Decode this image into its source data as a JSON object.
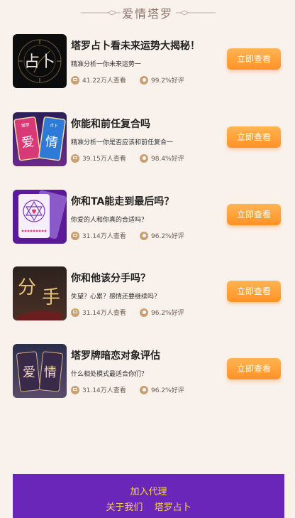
{
  "header": {
    "title": "爱情塔罗"
  },
  "items": [
    {
      "title": "塔罗占卜看未来运势大揭秘！",
      "desc": "精准分析一你未来运势一",
      "views": "41.22万人查看",
      "rating": "99.2%好评",
      "button": "立即查看",
      "thumb_text": "占卜"
    },
    {
      "title": "你能和前任复合吗",
      "desc": "精准分析一你是否应该和前任复合一",
      "views": "39.15万人查看",
      "rating": "98.4%好评",
      "button": "立即查看",
      "thumb_text_left": "爱",
      "thumb_text_right": "情",
      "thumb_label_left": "塔罗",
      "thumb_label_right": "占卜"
    },
    {
      "title": "你和TA能走到最后吗？",
      "desc": "你爱的人和你真的合适吗？",
      "views": "31.14万人查看",
      "rating": "96.2%好评",
      "button": "立即查看"
    },
    {
      "title": "你和他该分手吗？",
      "desc": "失望？心累？感情还要继续吗？",
      "views": "31.14万人查看",
      "rating": "96.2%好评",
      "button": "立即查看",
      "thumb_text_left": "分",
      "thumb_text_right": "手"
    },
    {
      "title": "塔罗牌暗恋对象评估",
      "desc": "什么相处模式最适合你们？",
      "views": "31.14万人查看",
      "rating": "96.2%好评",
      "button": "立即查看",
      "thumb_text_left": "爱",
      "thumb_text_right": "情"
    }
  ],
  "footer": {
    "join": "加入代理",
    "about": "关于我们",
    "tarot": "塔罗占卜"
  },
  "colors": {
    "background": "#f9f1eb",
    "button_gradient_top": "#ffb453",
    "button_gradient_bottom": "#ff9226",
    "footer_bg": "#6a26b8",
    "footer_text": "#f5d44a",
    "icon_accent": "#c9a074"
  },
  "icons": {
    "views": "views-icon",
    "rating": "thumbs-up-icon"
  }
}
